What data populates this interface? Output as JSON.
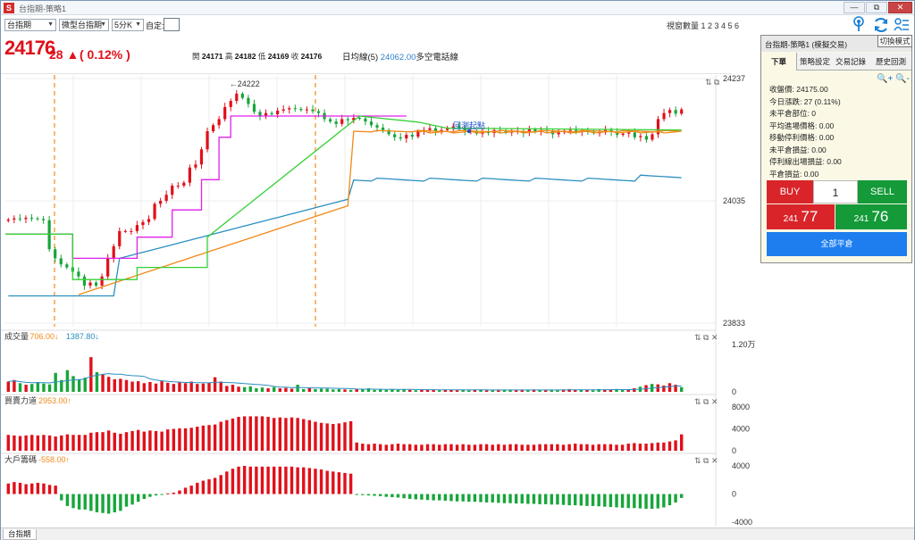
{
  "window": {
    "title": "台指期-策略1",
    "app_icon_label": "S",
    "minimize": "—",
    "restore": "⧉",
    "close": "✕"
  },
  "toolbar": {
    "symbol": "台指期",
    "contract": "微型台指期",
    "interval": "5分K",
    "custom_label": "自定:",
    "window_count": "視窗數量 1 2 3 4 5 6",
    "icons": [
      "broadcast-icon",
      "refresh-icon",
      "settings-list-icon"
    ]
  },
  "quote": {
    "price": "24176",
    "change": "28",
    "arrow": "▲",
    "change_pct": "( 0.12% )",
    "open_label": "開",
    "open": "24171",
    "high_label": "高",
    "high": "24182",
    "low_label": "低",
    "low": "24169",
    "close_label": "收",
    "close": "24176",
    "ma_label": "日均線(5)",
    "ma_value": "24062.00",
    "trend_label": "多空電話線"
  },
  "panel": {
    "title": "台指期-策略1 (模擬交易)",
    "switch_mode": "切換模式",
    "tabs": [
      "下單",
      "策略設定",
      "交易記錄",
      "歷史回測"
    ],
    "zoom_icons": "🔍+ 🔍-",
    "info": [
      "收盤價: 24175.00",
      "今日漲跌: 27 (0.11%)",
      "未平倉部位: 0",
      "平均進場價格: 0.00",
      "移動停利價格: 0.00",
      "未平倉損益: 0.00",
      "停利線出場損益: 0.00",
      "平倉損益: 0.00"
    ],
    "buy_label": "BUY",
    "sell_label": "SELL",
    "quantity": "1",
    "buy_price_prefix": "241",
    "buy_price_suffix": "77",
    "sell_price_prefix": "241",
    "sell_price_suffix": "76",
    "flatten_all": "全部平倉"
  },
  "status_bar": {
    "tab": "台指期"
  },
  "colors": {
    "up": "#e0101a",
    "down": "#17a63a",
    "accent": "#1a7fd6",
    "ma_cyan": "#2a8fc0",
    "ma_orange": "#f08a18",
    "magenta": "#e020e8",
    "green_line": "#35d035"
  },
  "chart_data": [
    {
      "type": "candlestick",
      "title": "",
      "y_axis_labels": [
        "24237",
        "24035",
        "23833"
      ],
      "ylim": [
        23833,
        24237
      ],
      "annotations": [
        "←24222",
        "回測起點"
      ],
      "session_separators": 2,
      "overlays": [
        "cyan moving average",
        "orange moving average",
        "magenta step line",
        "green step line"
      ],
      "close_approx": [
        24004,
        24006,
        24005,
        24007,
        24006,
        24005,
        24003,
        23955,
        23940,
        23930,
        23925,
        23918,
        23910,
        23895,
        23900,
        23895,
        23910,
        23940,
        23960,
        23985,
        23985,
        23985,
        23995,
        24000,
        24005,
        24030,
        24035,
        24045,
        24060,
        24060,
        24065,
        24090,
        24095,
        24120,
        24150,
        24160,
        24170,
        24190,
        24200,
        24212,
        24205,
        24195,
        24182,
        24175,
        24180,
        24178,
        24184,
        24186,
        24188,
        24187,
        24185,
        24186,
        24183,
        24180,
        24170,
        24166,
        24162,
        24170,
        24168,
        24172,
        24171,
        24166,
        24160,
        24156,
        24152,
        24145,
        24140,
        24138,
        24144,
        24141,
        24150,
        24152,
        24155,
        24150,
        24152,
        24156,
        24158,
        24155,
        24150,
        24150,
        24146,
        24150,
        24147,
        24152,
        24151,
        24148,
        24149,
        24150,
        24147,
        24153,
        24149,
        24152,
        24150,
        24145,
        24148,
        24151,
        24152,
        24149,
        24150,
        24149,
        24147,
        24148,
        24152,
        24149,
        24144,
        24146,
        24148,
        24140,
        24142,
        24136,
        24145,
        24170,
        24180,
        24185,
        24179,
        24186
      ]
    },
    {
      "type": "bar",
      "title": "成交量",
      "legend": [
        {
          "name": "706.00",
          "arrow": "↓"
        },
        {
          "name": "1387.80",
          "arrow": "↓"
        }
      ],
      "y_axis_labels": [
        "1.20万",
        "0"
      ],
      "ylim": [
        0,
        12000
      ],
      "values_approx": [
        2600,
        3000,
        2200,
        1800,
        2000,
        2500,
        2100,
        1900,
        4800,
        3000,
        5500,
        4000,
        3200,
        3600,
        8800,
        5000,
        4500,
        3800,
        3200,
        3300,
        3000,
        2600,
        2700,
        2200,
        2500,
        2100,
        2700,
        2300,
        2000,
        2500,
        2200,
        2600,
        2000,
        2100,
        2300,
        3700,
        2600,
        1500,
        1800,
        1300,
        1200,
        1400,
        900,
        1100,
        900,
        1200,
        900,
        1000,
        800,
        1800,
        700,
        900,
        700,
        800,
        800,
        600,
        700,
        600,
        500,
        700,
        600,
        900,
        500,
        600,
        500,
        700,
        500,
        600,
        500,
        400,
        500,
        600,
        500,
        400,
        600,
        500,
        400,
        500,
        400,
        500,
        600,
        400,
        500,
        400,
        500,
        500,
        400,
        500,
        400,
        600,
        500,
        400,
        500,
        400,
        600,
        700,
        500,
        600,
        500,
        400,
        700,
        500,
        600,
        700,
        500,
        600,
        900,
        1300,
        1700,
        2000,
        1900,
        1600,
        2200,
        1800,
        1200
      ]
    },
    {
      "type": "bar",
      "title": "買賣力道",
      "legend": [
        {
          "name": "2953.00",
          "arrow": "↑"
        }
      ],
      "y_axis_labels": [
        "8000",
        "4000",
        "0"
      ],
      "ylim": [
        0,
        8000
      ],
      "values_approx": [
        2900,
        2800,
        2700,
        2800,
        2900,
        2800,
        2900,
        2800,
        2600,
        2800,
        3000,
        2900,
        2900,
        2900,
        3300,
        3400,
        3400,
        3700,
        3300,
        3100,
        3400,
        3600,
        3800,
        3500,
        3700,
        3600,
        3500,
        3900,
        4000,
        4100,
        4100,
        4200,
        4400,
        4600,
        4700,
        4800,
        5300,
        5600,
        5900,
        6200,
        6300,
        6300,
        6300,
        6300,
        6200,
        6000,
        6100,
        6000,
        6100,
        6000,
        5800,
        5600,
        5300,
        5100,
        5000,
        4900,
        5000,
        5200,
        5400,
        1500,
        1300,
        1200,
        1300,
        1200,
        1100,
        1200,
        1300,
        1200,
        1200,
        1100,
        1100,
        1200,
        1200,
        1100,
        1200,
        1200,
        1100,
        1200,
        1100,
        1100,
        1200,
        1200,
        1100,
        1200,
        1100,
        1200,
        1200,
        1100,
        1100,
        1100,
        1200,
        1200,
        1200,
        1200,
        1100,
        1200,
        1300,
        1200,
        1200,
        1100,
        1200,
        1200,
        1200,
        1100,
        1100,
        1300,
        1400,
        1300,
        1300,
        1400,
        1500,
        1500,
        1700,
        1900,
        3000
      ]
    },
    {
      "type": "bar",
      "title": "大戶籌碼",
      "legend": [
        {
          "name": "-558.00",
          "arrow": "↑"
        }
      ],
      "y_axis_labels": [
        "4000",
        "0",
        "-4000"
      ],
      "ylim": [
        -4000,
        4000
      ],
      "values_approx": [
        1500,
        1700,
        1600,
        1400,
        1500,
        1600,
        1500,
        1300,
        1200,
        -900,
        -1700,
        -2000,
        -2200,
        -2200,
        -2400,
        -2600,
        -2700,
        -2800,
        -2600,
        -2400,
        -1800,
        -1500,
        -1100,
        -700,
        -400,
        -200,
        -100,
        100,
        200,
        500,
        900,
        1200,
        1600,
        1900,
        2100,
        2300,
        2700,
        3200,
        3600,
        3900,
        4000,
        3900,
        3900,
        3900,
        3900,
        3900,
        3900,
        3900,
        3900,
        3800,
        3800,
        3700,
        3600,
        3500,
        3300,
        3200,
        3100,
        3000,
        2900,
        -100,
        -150,
        -200,
        -250,
        -300,
        -400,
        -450,
        -500,
        -600,
        -700,
        -750,
        -800,
        -850,
        -900,
        -900,
        -950,
        -1000,
        -1050,
        -1050,
        -1100,
        -1100,
        -1150,
        -1200,
        -1200,
        -1250,
        -1300,
        -1300,
        -1350,
        -1350,
        -1400,
        -1400,
        -1450,
        -1450,
        -1500,
        -1500,
        -1550,
        -1600,
        -1600,
        -1650,
        -1700,
        -1700,
        -1750,
        -1800,
        -1850,
        -1900,
        -1950,
        -2000,
        -2000,
        -2050,
        -2100,
        -2100,
        -2050,
        -1900,
        -1600,
        -1200,
        -558
      ]
    }
  ]
}
